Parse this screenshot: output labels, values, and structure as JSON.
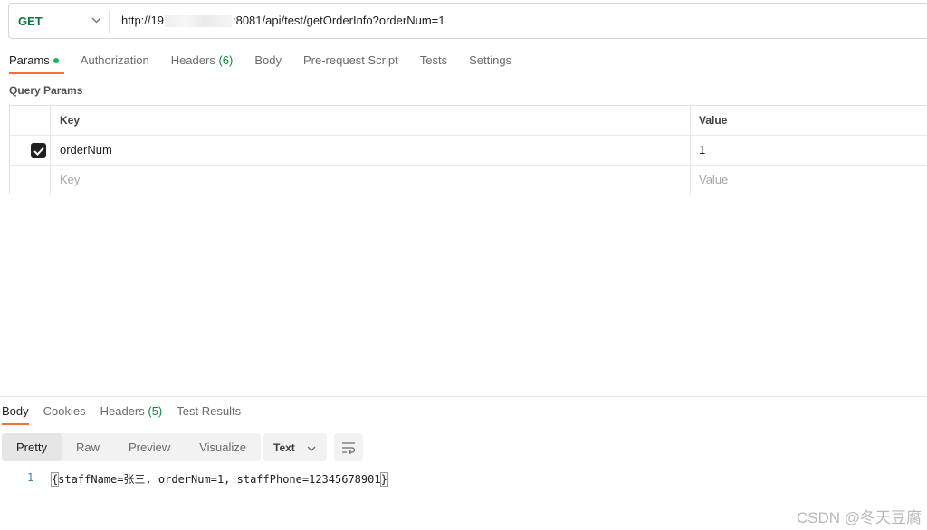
{
  "request": {
    "method": "GET",
    "url_prefix": "http://19",
    "url_suffix": ":8081/api/test/getOrderInfo?orderNum=1"
  },
  "request_tabs": [
    {
      "label": "Params",
      "count": "",
      "active": true
    },
    {
      "label": "Authorization",
      "count": ""
    },
    {
      "label": "Headers",
      "count": "(6)"
    },
    {
      "label": "Body",
      "count": ""
    },
    {
      "label": "Pre-request Script",
      "count": ""
    },
    {
      "label": "Tests",
      "count": ""
    },
    {
      "label": "Settings",
      "count": ""
    }
  ],
  "query_params": {
    "title": "Query Params",
    "headers": {
      "key": "Key",
      "value": "Value"
    },
    "rows": [
      {
        "checked": true,
        "key": "orderNum",
        "value": "1"
      }
    ],
    "placeholder": {
      "key": "Key",
      "value": "Value"
    }
  },
  "response_tabs": [
    {
      "label": "Body",
      "count": "",
      "active": true
    },
    {
      "label": "Cookies",
      "count": ""
    },
    {
      "label": "Headers",
      "count": "(5)"
    },
    {
      "label": "Test Results",
      "count": ""
    }
  ],
  "view_modes": [
    "Pretty",
    "Raw",
    "Preview",
    "Visualize"
  ],
  "active_view": "Pretty",
  "format": "Text",
  "response_body": {
    "line_number": "1",
    "open_brace": "{",
    "text": "staffName=张三, orderNum=1, staffPhone=12345678901",
    "close_brace": "}"
  },
  "watermark": "CSDN @冬天豆腐",
  "colors": {
    "accent": "#ff6c37",
    "method_get": "#0b7a3e",
    "active_dot": "#0cbb52"
  }
}
